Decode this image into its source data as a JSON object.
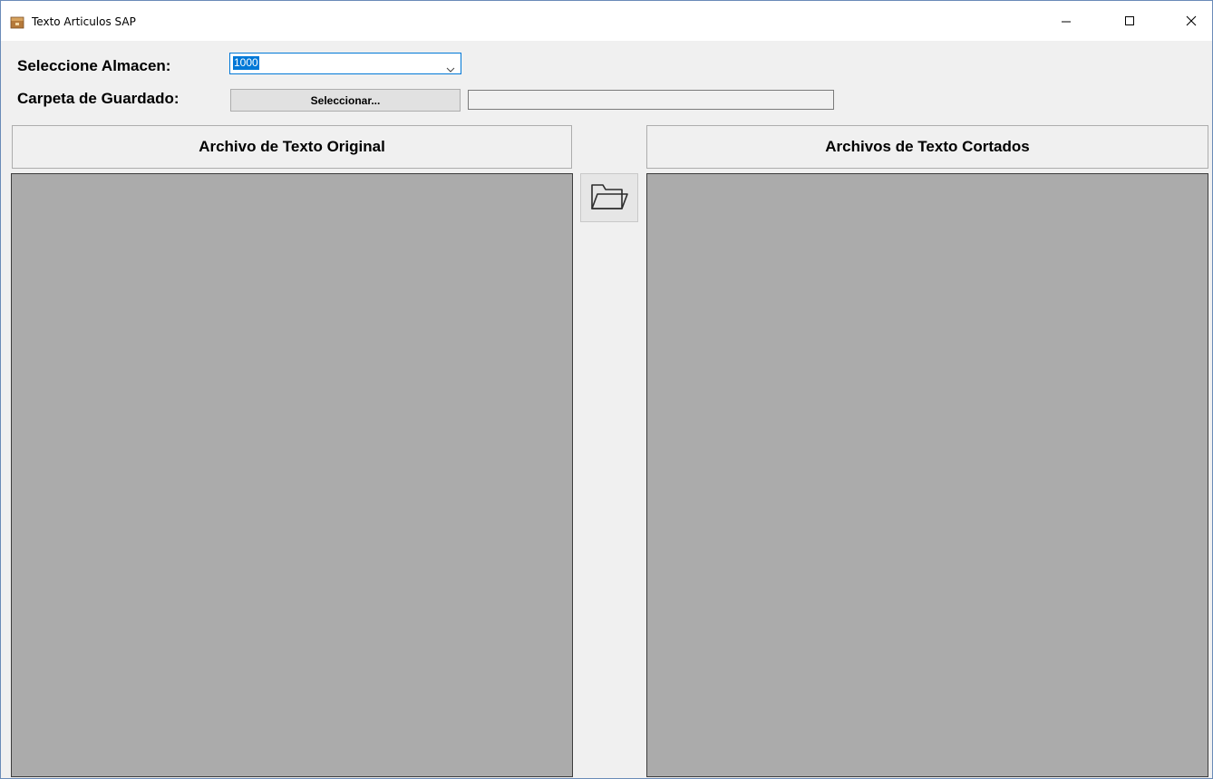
{
  "window": {
    "title": "Texto Articulos SAP"
  },
  "form": {
    "almacen_label": "Seleccione Almacen:",
    "almacen_value": "1000",
    "carpeta_label": "Carpeta de Guardado:",
    "select_button": "Seleccionar...",
    "path_value": ""
  },
  "panels": {
    "original_header": "Archivo de Texto Original",
    "cortados_header": "Archivos de Texto Cortados"
  },
  "icons": {
    "app": "package-icon",
    "open": "folder-open-icon"
  },
  "colors": {
    "accent": "#0078d7",
    "panel_bg": "#ababab",
    "window_bg": "#f0f0f0"
  }
}
